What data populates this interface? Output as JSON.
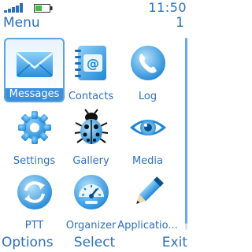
{
  "status": {
    "time": "11:50",
    "page": "1"
  },
  "title": "Menu",
  "menu": {
    "items": [
      {
        "label": "Messages",
        "icon": "envelope-icon"
      },
      {
        "label": "Contacts",
        "icon": "address-book-icon"
      },
      {
        "label": "Log",
        "icon": "phone-handset-icon"
      },
      {
        "label": "Settings",
        "icon": "gear-icon"
      },
      {
        "label": "Gallery",
        "icon": "ladybug-icon"
      },
      {
        "label": "Media",
        "icon": "eye-icon"
      },
      {
        "label": "PTT",
        "icon": "sync-arrows-icon"
      },
      {
        "label": "Organizer",
        "icon": "gauge-icon"
      },
      {
        "label": "Applicatio...",
        "icon": "pencil-icon"
      }
    ],
    "selected_index": 0
  },
  "softkeys": {
    "left": "Options",
    "middle": "Select",
    "right": "Exit"
  },
  "colors": {
    "accent": "#2d6fbf",
    "selection": "#3d8fd8",
    "icon_light": "#7cc4f2",
    "icon_dark": "#1f87d6"
  }
}
